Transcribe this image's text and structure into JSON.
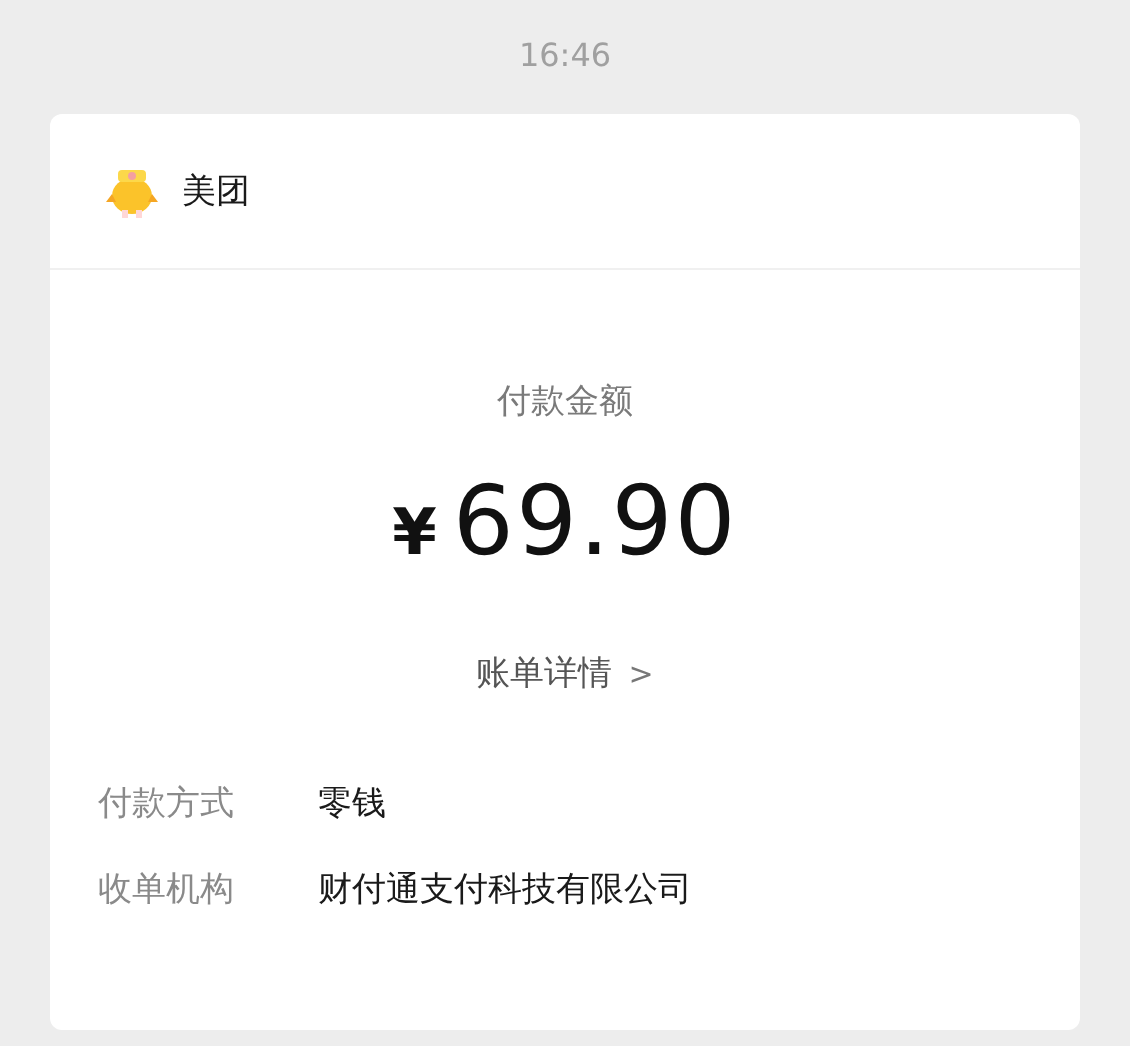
{
  "timestamp": "16:46",
  "card": {
    "merchant": "美团",
    "amount_label": "付款金额",
    "currency": "¥",
    "amount": "69.90",
    "details_link": "账单详情",
    "details_chevron": ">",
    "fields": [
      {
        "label": "付款方式",
        "value": "零钱"
      },
      {
        "label": "收单机构",
        "value": "财付通支付科技有限公司"
      }
    ]
  }
}
